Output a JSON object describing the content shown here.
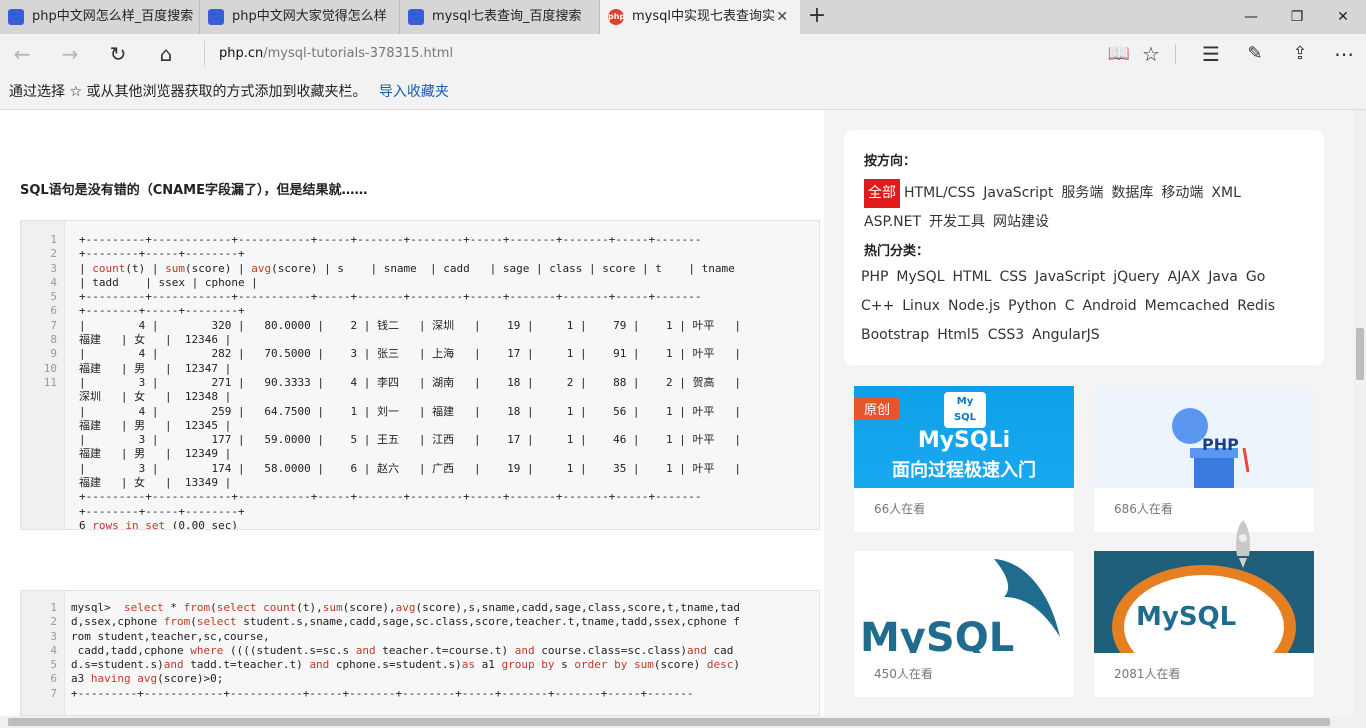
{
  "tabs": [
    {
      "title": "php中文网怎么样_百度搜索",
      "icon": "baidu-paw-icon"
    },
    {
      "title": "php中文网大家觉得怎么样",
      "icon": "baidu-paw-icon"
    },
    {
      "title": "mysql七表查询_百度搜索",
      "icon": "baidu-paw-icon"
    },
    {
      "title": "mysql中实现七表查询实",
      "icon": "php-logo-icon",
      "favicon_text": "php"
    }
  ],
  "address": {
    "host": "php.cn",
    "path": "/mysql-tutorials-378315.html"
  },
  "favbar": {
    "text": "通过选择 ☆ 或从其他浏览器获取的方式添加到收藏夹栏。",
    "link": "导入收藏夹"
  },
  "article": {
    "heading": "SQL语句是没有错的（CNAME字段漏了），但是结果就……",
    "code1": {
      "line_numbers": [
        "1",
        "2",
        "3",
        "4",
        "5",
        "6",
        "7",
        "8",
        "9",
        "10",
        "11"
      ],
      "lines": [
        "+---------+------------+-----------+-----+-------+--------+-----+-------+-------+-----+-------",
        "+--------+-----+--------+",
        "| count(t) | sum(score) | avg(score) | s    | sname  | cadd   | sage | class | score | t    | tname",
        "| tadd    | ssex | cphone |",
        "+---------+------------+-----------+-----+-------+--------+-----+-------+-------+-----+-------",
        "+--------+-----+--------+",
        "|        4 |        320 |   80.0000 |    2 | 钱二   | 深圳   |    19 |     1 |    79 |    1 | 叶平   |",
        "福建   | 女   |  12346 |",
        "|        4 |        282 |   70.5000 |    3 | 张三   | 上海   |    17 |     1 |    91 |    1 | 叶平   |",
        "福建   | 男   |  12347 |",
        "|        3 |        271 |   90.3333 |    4 | 李四   | 湖南   |    18 |     2 |    88 |    2 | 贺高   |",
        "深圳   | 女   |  12348 |",
        "|        4 |        259 |   64.7500 |    1 | 刘一   | 福建   |    18 |     1 |    56 |    1 | 叶平   |",
        "福建   | 男   |  12345 |",
        "|        3 |        177 |   59.0000 |    5 | 王五   | 江西   |    17 |     1 |    46 |    1 | 叶平   |",
        "福建   | 男   |  12349 |",
        "|        3 |        174 |   58.0000 |    6 | 赵六   | 广西   |    19 |     1 |    35 |    1 | 叶平   |",
        "福建   | 女   |  13349 |",
        "+---------+------------+-----------+-----+-------+--------+-----+-------+-------+-----+-------",
        "+--------+-----+--------+",
        "6 rows in set (0.00 sec)"
      ]
    },
    "code2": {
      "line_numbers": [
        "1",
        "2",
        "3",
        "4",
        "5",
        "6",
        "7"
      ],
      "lines": [
        "mysql>  select * from(select count(t),sum(score),avg(score),s,sname,cadd,sage,class,score,t,tname,tad",
        "d,ssex,cphone from(select student.s,sname,cadd,sage,sc.class,score,teacher.t,tname,tadd,ssex,cphone f",
        "rom student,teacher,sc,course,",
        " cadd,tadd,cphone where ((((student.s=sc.s and teacher.t=course.t) and course.class=sc.class)and cad",
        "d.s=student.s)and tadd.t=teacher.t) and cphone.s=student.s)as a1 group by s order by sum(score) desc)",
        "a3 having avg(score)>0;",
        "+---------+------------+-----------+-----+-------+--------+-----+-------+-------+-----+-------"
      ]
    }
  },
  "sidebar": {
    "direction_label": "按方向：",
    "directions": [
      "全部",
      "HTML/CSS",
      "JavaScript",
      "服务端",
      "数据库",
      "移动端",
      "XML",
      "ASP.NET",
      "开发工具",
      "网站建设"
    ],
    "hot_label": "热门分类：",
    "hot": [
      "PHP",
      "MySQL",
      "HTML",
      "CSS",
      "JavaScript",
      "jQuery",
      "AJAX",
      "Java",
      "Go",
      "C++",
      "Linux",
      "Node.js",
      "Python",
      "C",
      "Android",
      "Memcached",
      "Redis",
      "Bootstrap",
      "Html5",
      "CSS3",
      "AngularJS"
    ],
    "courses": [
      {
        "views": "66人在看",
        "badge": "原创",
        "title1": "MySQLi",
        "title2": "面向过程极速入门",
        "logo": "My SQL"
      },
      {
        "views": "686人在看",
        "logo": "PHP"
      },
      {
        "views": "450人在看",
        "logo": "MySQL"
      },
      {
        "views": "2081人在看",
        "logo": "MySQL"
      }
    ]
  },
  "colors": {
    "accent": "#e01b1b",
    "link": "#1a5cae",
    "keyword": "#c0392b"
  }
}
